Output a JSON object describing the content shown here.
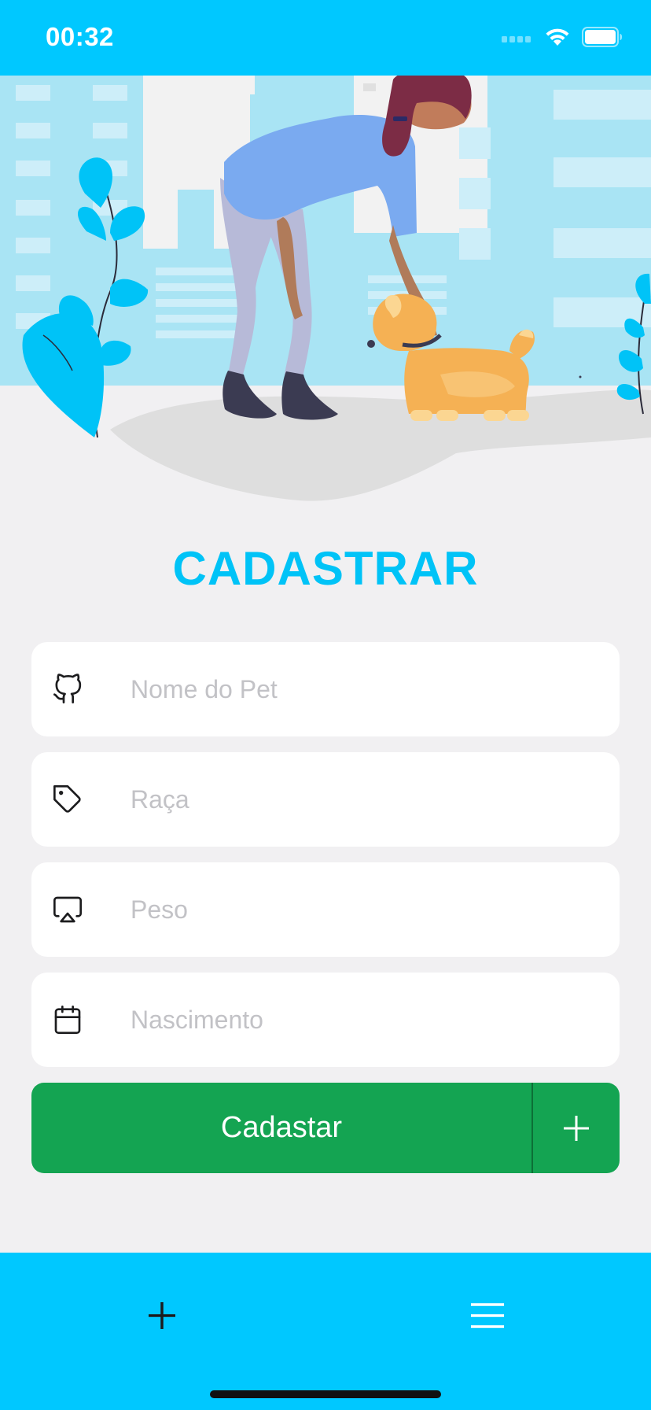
{
  "status_bar": {
    "time": "00:32"
  },
  "title": "CADASTRAR",
  "form": {
    "fields": [
      {
        "icon": "github-icon",
        "placeholder": "Nome do Pet",
        "value": ""
      },
      {
        "icon": "tag-icon",
        "placeholder": "Raça",
        "value": ""
      },
      {
        "icon": "airplay-icon",
        "placeholder": "Peso",
        "value": ""
      },
      {
        "icon": "calendar-icon",
        "placeholder": "Nascimento",
        "value": ""
      }
    ],
    "submit_label": "Cadastar"
  },
  "tab_bar": {
    "items": [
      {
        "icon": "plus-icon"
      },
      {
        "icon": "menu-icon"
      }
    ]
  },
  "colors": {
    "accent": "#00c8ff",
    "title": "#00c3f7",
    "button": "#14a452",
    "background": "#f1f0f2"
  }
}
